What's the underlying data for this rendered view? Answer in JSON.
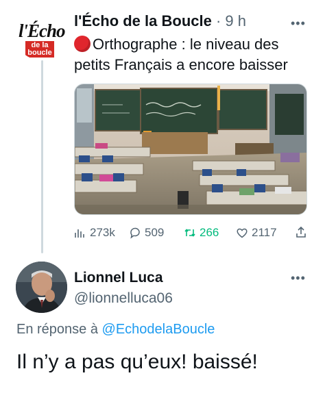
{
  "original_tweet": {
    "avatar_logo_top": "l'Écho",
    "avatar_logo_box": "de la boucle",
    "author_name": "l'Écho de la Boucle",
    "separator": " · ",
    "time": "9 h",
    "more_icon": "more-dots-icon",
    "text": "Orthographe : le niveau des petits Français a encore baisser",
    "photo": "classroom-photo",
    "stats": {
      "views": "273k",
      "replies": "509",
      "retweets": "266",
      "likes": "2117"
    },
    "retweet_color": "#00ba7c",
    "emoji_color": "#e0262d"
  },
  "reply": {
    "author_name": "Lionnel Luca",
    "handle": "@lionnelluca06",
    "reply_prefix": "En réponse à ",
    "reply_mention": "@EchodelaBoucle",
    "text": "Il n’y a pas qu’eux! baissé!",
    "mention_color": "#1d9bf0"
  }
}
